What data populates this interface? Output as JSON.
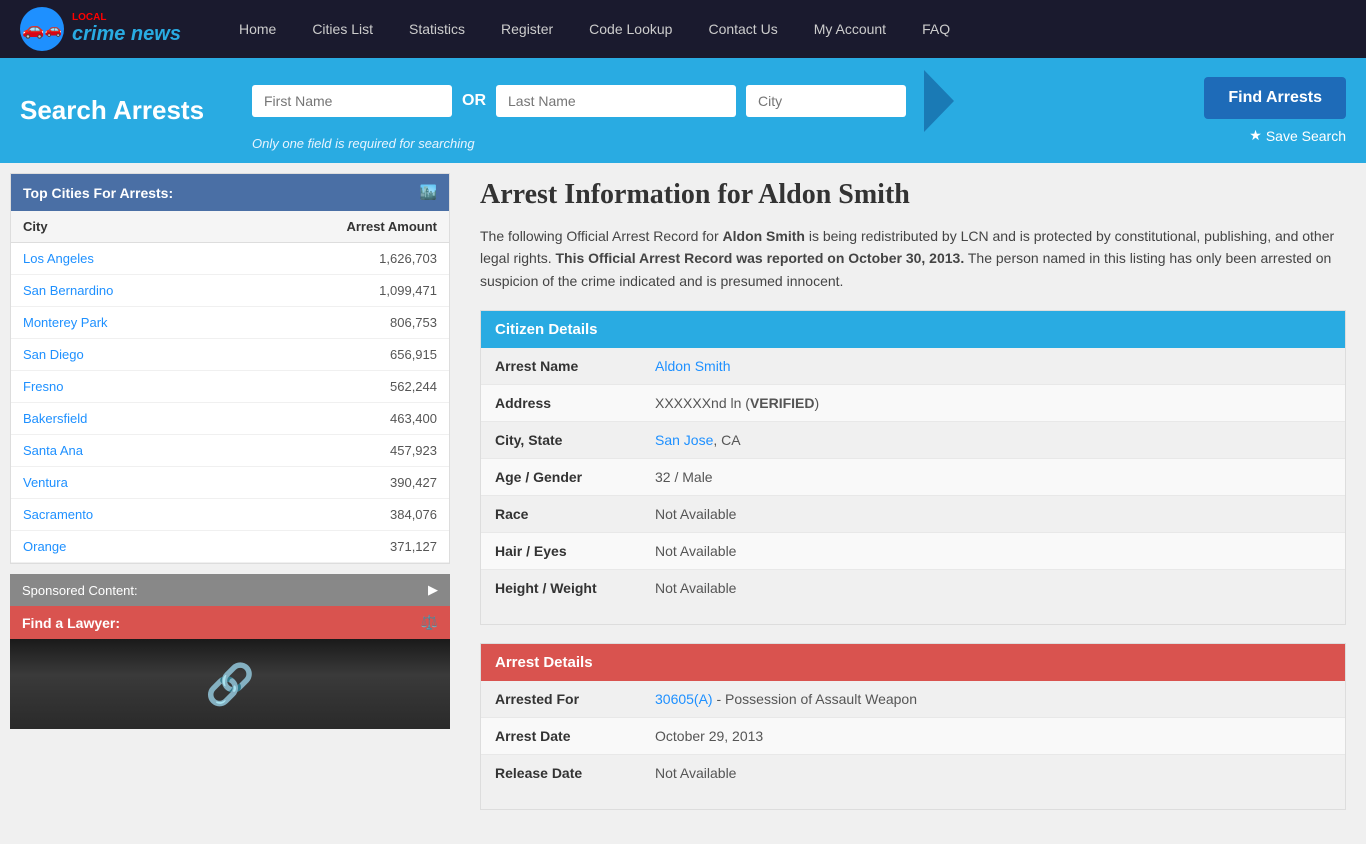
{
  "nav": {
    "logo_text": "crime news",
    "logo_local": "LOCAL",
    "links": [
      {
        "label": "Home",
        "name": "nav-home"
      },
      {
        "label": "Cities List",
        "name": "nav-cities-list"
      },
      {
        "label": "Statistics",
        "name": "nav-statistics"
      },
      {
        "label": "Register",
        "name": "nav-register"
      },
      {
        "label": "Code Lookup",
        "name": "nav-code-lookup"
      },
      {
        "label": "Contact Us",
        "name": "nav-contact-us"
      },
      {
        "label": "My Account",
        "name": "nav-my-account"
      },
      {
        "label": "FAQ",
        "name": "nav-faq"
      }
    ]
  },
  "search_bar": {
    "title": "Search Arrests",
    "first_name_placeholder": "First Name",
    "or_label": "OR",
    "last_name_placeholder": "Last Name",
    "city_placeholder": "City",
    "hint": "Only one field is required for searching",
    "find_button": "Find Arrests",
    "save_search": "Save Search"
  },
  "sidebar": {
    "top_cities_header": "Top Cities For Arrests:",
    "col_city": "City",
    "col_amount": "Arrest Amount",
    "cities": [
      {
        "name": "Los Angeles",
        "amount": "1,626,703"
      },
      {
        "name": "San Bernardino",
        "amount": "1,099,471"
      },
      {
        "name": "Monterey Park",
        "amount": "806,753"
      },
      {
        "name": "San Diego",
        "amount": "656,915"
      },
      {
        "name": "Fresno",
        "amount": "562,244"
      },
      {
        "name": "Bakersfield",
        "amount": "463,400"
      },
      {
        "name": "Santa Ana",
        "amount": "457,923"
      },
      {
        "name": "Ventura",
        "amount": "390,427"
      },
      {
        "name": "Sacramento",
        "amount": "384,076"
      },
      {
        "name": "Orange",
        "amount": "371,127"
      }
    ],
    "sponsored_label": "Sponsored Content:",
    "lawyer_label": "Find a Lawyer:"
  },
  "content": {
    "title": "Arrest Information for Aldon Smith",
    "intro_part1": "The following Official Arrest Record for ",
    "intro_name": "Aldon Smith",
    "intro_part2": " is being redistributed by LCN and is protected by constitutional, publishing, and other legal rights. ",
    "intro_bold": "This Official Arrest Record was reported on October 30, 2013.",
    "intro_part3": " The person named in this listing has only been arrested on suspicion of the crime indicated and is presumed innocent.",
    "citizen_header": "Citizen Details",
    "arrest_details_header": "Arrest Details",
    "fields": {
      "arrest_name_label": "Arrest Name",
      "arrest_name_value": "Aldon Smith",
      "address_label": "Address",
      "address_value": "XXXXXXnd ln (",
      "address_verified": "VERIFIED",
      "address_end": ")",
      "city_state_label": "City, State",
      "city_value": "San Jose",
      "state_value": ", CA",
      "age_gender_label": "Age / Gender",
      "age_gender_value": "32 / Male",
      "race_label": "Race",
      "race_value": "Not Available",
      "hair_eyes_label": "Hair / Eyes",
      "hair_eyes_value": "Not Available",
      "height_weight_label": "Height / Weight",
      "height_weight_value": "Not Available",
      "arrested_for_label": "Arrested For",
      "arrested_for_code": "30605(A)",
      "arrested_for_desc": " - Possession of Assault Weapon",
      "arrest_date_label": "Arrest Date",
      "arrest_date_value": "October 29, 2013",
      "release_date_label": "Release Date",
      "release_date_value": "Not Available"
    }
  }
}
